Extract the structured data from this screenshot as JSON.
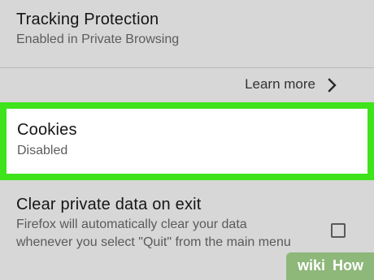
{
  "tracking_protection": {
    "title": "Tracking Protection",
    "subtitle": "Enabled in Private Browsing"
  },
  "learn_more": {
    "label": "Learn more",
    "icon": "chevron-right-icon"
  },
  "cookies": {
    "title": "Cookies",
    "subtitle": "Disabled",
    "highlight_color": "#3fe31c"
  },
  "clear_private_data": {
    "title": "Clear private data on exit",
    "description": "Firefox will automatically clear your data whenever you select \"Quit\" from the main menu",
    "checked": false
  },
  "watermark": {
    "wiki": "wiki",
    "how": "How"
  }
}
